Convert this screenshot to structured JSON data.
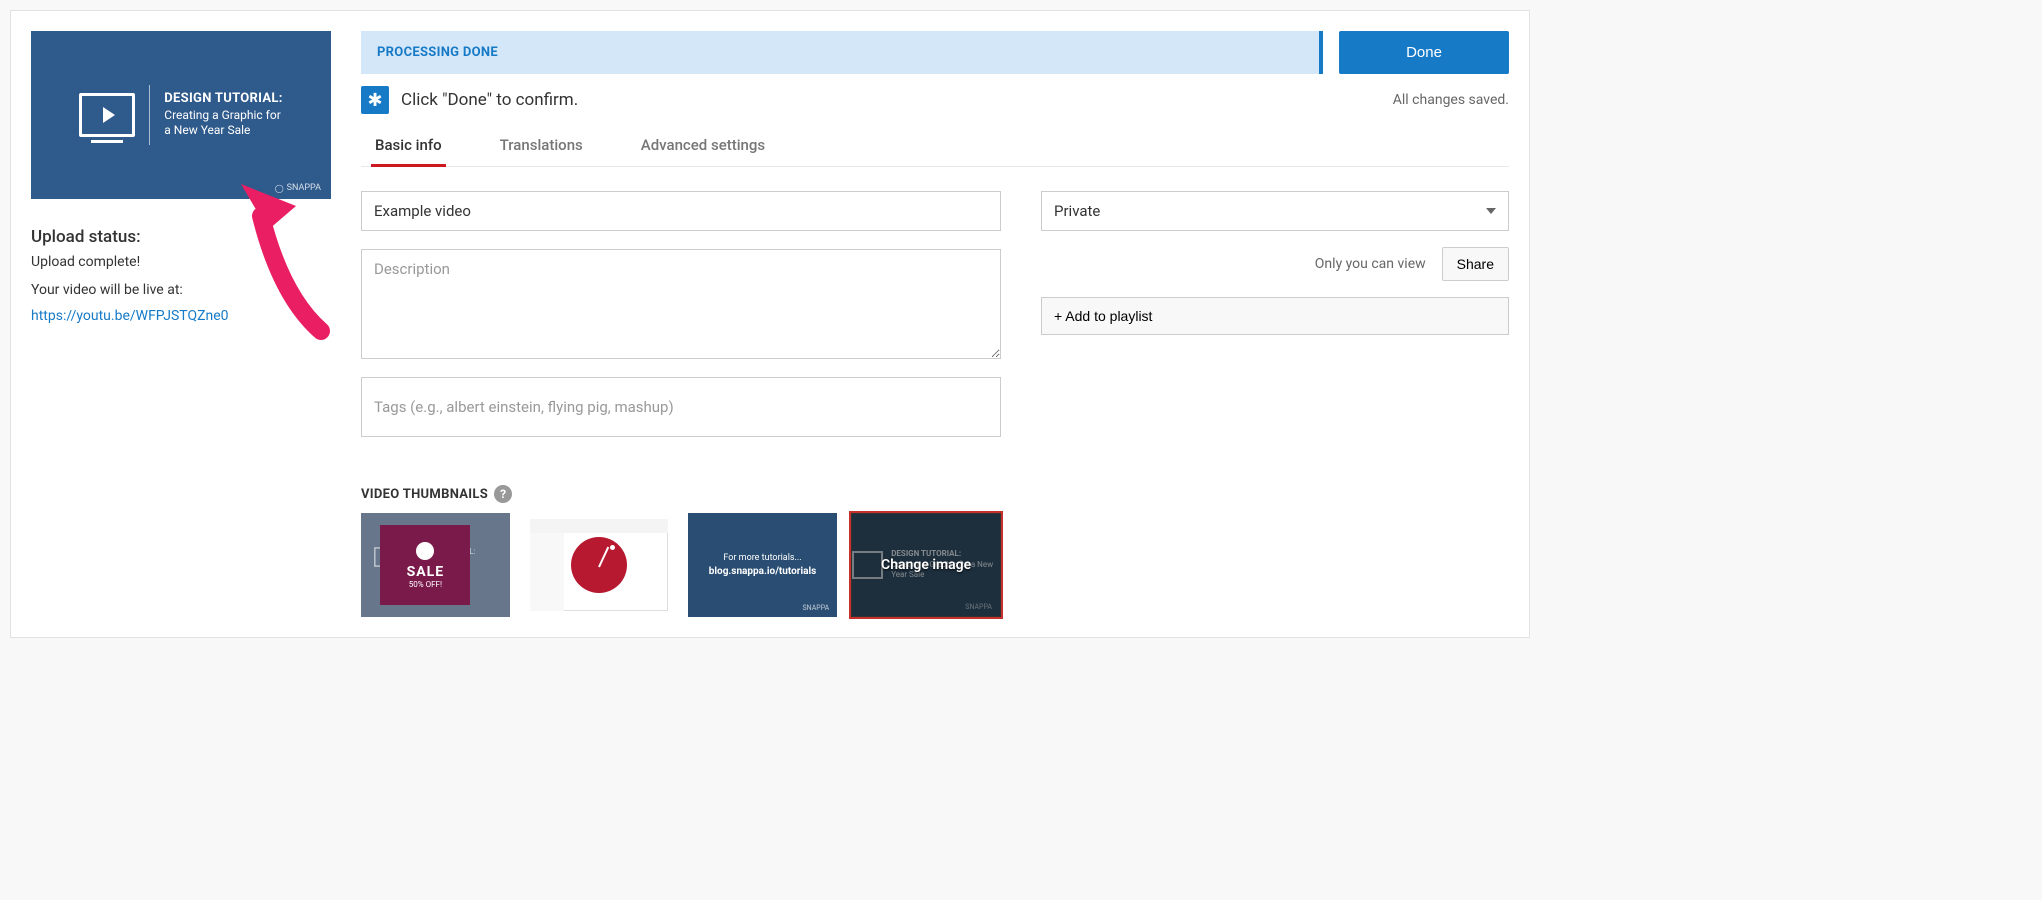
{
  "thumb_preview": {
    "title": "DESIGN TUTORIAL:",
    "line1": "Creating a Graphic for",
    "line2": "a New Year Sale",
    "brand": "SNAPPA"
  },
  "left": {
    "status_heading": "Upload status:",
    "status_text": "Upload complete!",
    "live_text": "Your video will be live at:",
    "video_url": "https://youtu.be/WFPJSTQZne0"
  },
  "header": {
    "processing": "PROCESSING DONE",
    "done_button": "Done"
  },
  "confirm": {
    "message": "Click \"Done\" to confirm.",
    "saved": "All changes saved."
  },
  "tabs": {
    "basic": "Basic info",
    "translations": "Translations",
    "advanced": "Advanced settings"
  },
  "form": {
    "title_value": "Example video",
    "description_placeholder": "Description",
    "tags_placeholder": "Tags (e.g., albert einstein, flying pig, mashup)"
  },
  "privacy": {
    "selected": "Private",
    "note": "Only you can view",
    "share_label": "Share"
  },
  "playlist": {
    "label": "+ Add to playlist"
  },
  "thumbs": {
    "heading": "VIDEO THUMBNAILS",
    "change_label": "Change image",
    "a": {
      "tutorial": "DESIGN TUTORIAL:",
      "sale": "SALE",
      "pct": "50% OFF!"
    },
    "c": {
      "line1": "For more tutorials...",
      "line2": "blog.snappa.io/tutorials",
      "brand": "SNAPPA"
    },
    "d": {
      "title": "DESIGN TUTORIAL:",
      "sub": "Creating a Graphic for a New Year Sale",
      "brand": "SNAPPA"
    }
  }
}
